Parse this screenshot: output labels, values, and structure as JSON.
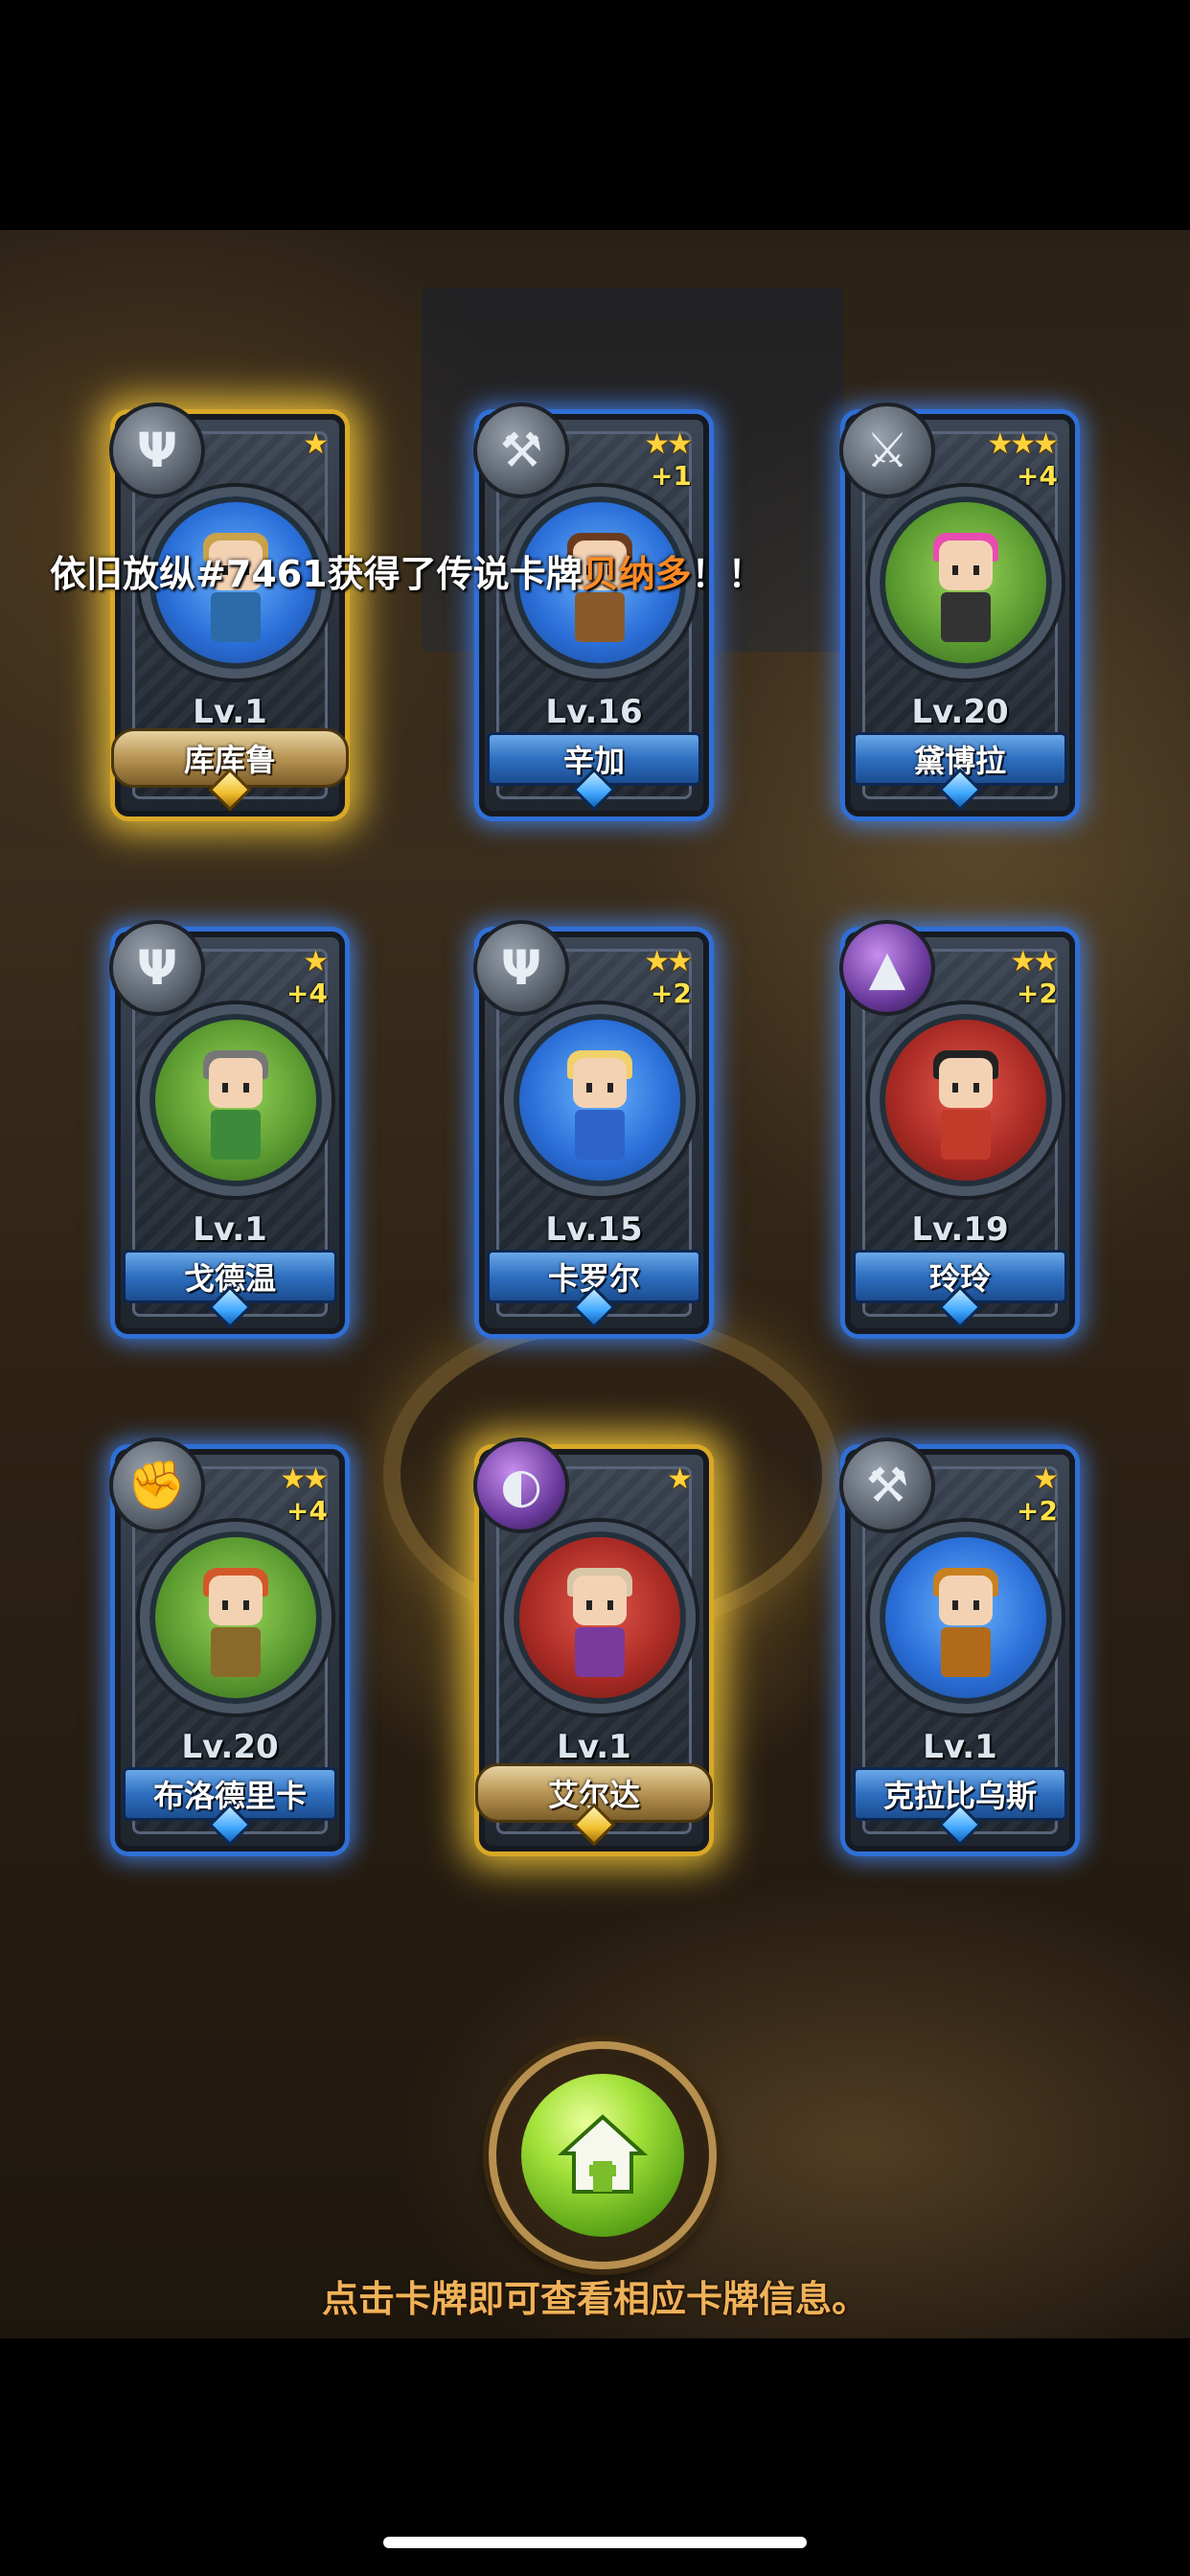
{
  "broadcast": {
    "prefix": "依旧放纵#7461获得了传说卡牌",
    "highlight": "贝纳多",
    "suffix": "！！"
  },
  "cards": [
    {
      "name": "库库鲁",
      "level": "Lv.1",
      "stars": "★",
      "plus": "",
      "frame": "gold",
      "weapon": "trident-icon",
      "portrait": "blue"
    },
    {
      "name": "辛加",
      "level": "Lv.16",
      "stars": "★★",
      "plus": "+1",
      "frame": "blue",
      "weapon": "axe-icon",
      "portrait": "blue"
    },
    {
      "name": "黛博拉",
      "level": "Lv.20",
      "stars": "★★★",
      "plus": "+4",
      "frame": "blue",
      "weapon": "crossed-swords-icon",
      "portrait": "green"
    },
    {
      "name": "戈德温",
      "level": "Lv.1",
      "stars": "★",
      "plus": "+4",
      "frame": "blue",
      "weapon": "trident-icon",
      "portrait": "green"
    },
    {
      "name": "卡罗尔",
      "level": "Lv.15",
      "stars": "★★",
      "plus": "+2",
      "frame": "blue",
      "weapon": "trident-icon",
      "portrait": "blue"
    },
    {
      "name": "玲玲",
      "level": "Lv.19",
      "stars": "★★",
      "plus": "+2",
      "frame": "blue",
      "weapon": "wizard-hat-icon",
      "portrait": "red"
    },
    {
      "name": "布洛德里卡",
      "level": "Lv.20",
      "stars": "★★",
      "plus": "+4",
      "frame": "blue",
      "weapon": "fist-icon",
      "portrait": "green"
    },
    {
      "name": "艾尔达",
      "level": "Lv.1",
      "stars": "★",
      "plus": "",
      "frame": "gold",
      "weapon": "magic-orb-icon",
      "portrait": "red"
    },
    {
      "name": "克拉比乌斯",
      "level": "Lv.1",
      "stars": "★",
      "plus": "+2",
      "frame": "blue",
      "weapon": "axe-icon",
      "portrait": "blue"
    }
  ],
  "home_button": {
    "icon": "home-icon"
  },
  "hint": "点击卡牌即可查看相应卡牌信息。",
  "colors": {
    "highlight": "#ff8a24",
    "hint": "#f0b25a",
    "blue_glow": "#2f6fd6",
    "gold_glow": "#d9a826"
  }
}
